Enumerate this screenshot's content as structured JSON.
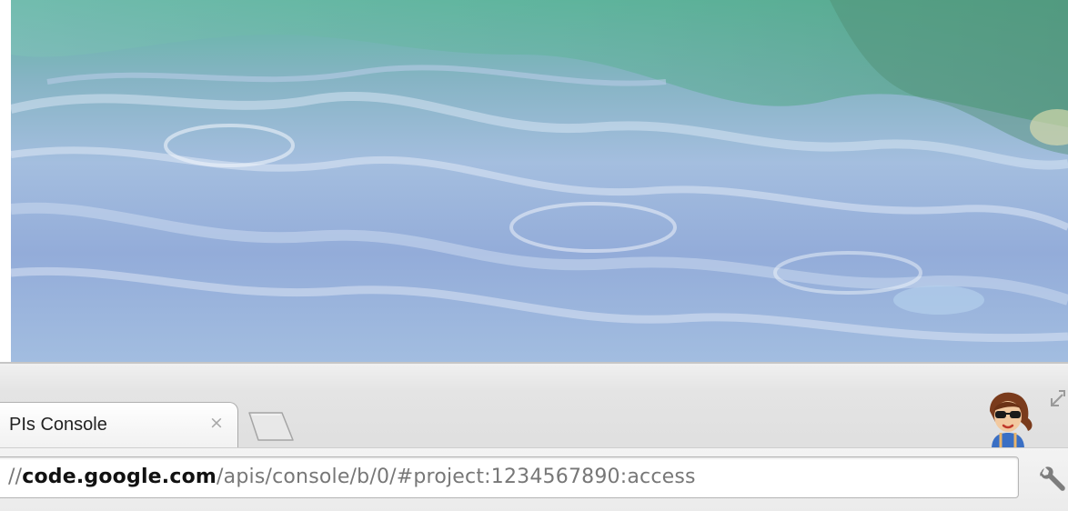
{
  "tab": {
    "title": "PIs Console",
    "close_glyph": "×"
  },
  "address_bar": {
    "prefix": "//",
    "domain": "code.google.com",
    "path": "/apis/console/b/0/#project:1234567890:access"
  },
  "icons": {
    "tab_close": "close-icon",
    "new_tab": "new-tab-icon",
    "profile": "avatar",
    "corner": "resize-icon",
    "menu": "wrench-icon"
  },
  "colors": {
    "url_domain": "#111111",
    "url_path": "#777777",
    "wallpaper_primary": "#9bb6da",
    "wallpaper_accent": "#6fb8a8"
  }
}
